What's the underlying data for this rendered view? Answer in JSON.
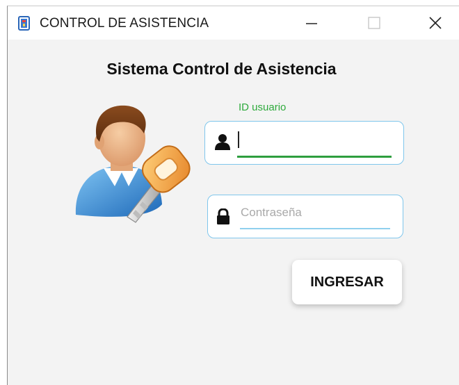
{
  "window": {
    "title": "CONTROL DE ASISTENCIA",
    "controls": {
      "minimize": "minimize-icon",
      "maximize": "maximize-icon",
      "close": "close-icon"
    }
  },
  "login": {
    "heading": "Sistema Control de Asistencia",
    "user_label": "ID usuario",
    "user_value": "",
    "password_placeholder": "Contraseña",
    "password_value": "",
    "submit_label": "INGRESAR",
    "icons": {
      "avatar": "user-key-icon",
      "user": "user-icon",
      "password": "lock-icon"
    }
  },
  "colors": {
    "window_bg": "#f3f3f3",
    "titlebar_bg": "#ffffff",
    "field_border": "#7fc6ec",
    "active_underline": "#2e9e3e",
    "label_green": "#2eaa3c",
    "placeholder": "#a9a9a9"
  }
}
